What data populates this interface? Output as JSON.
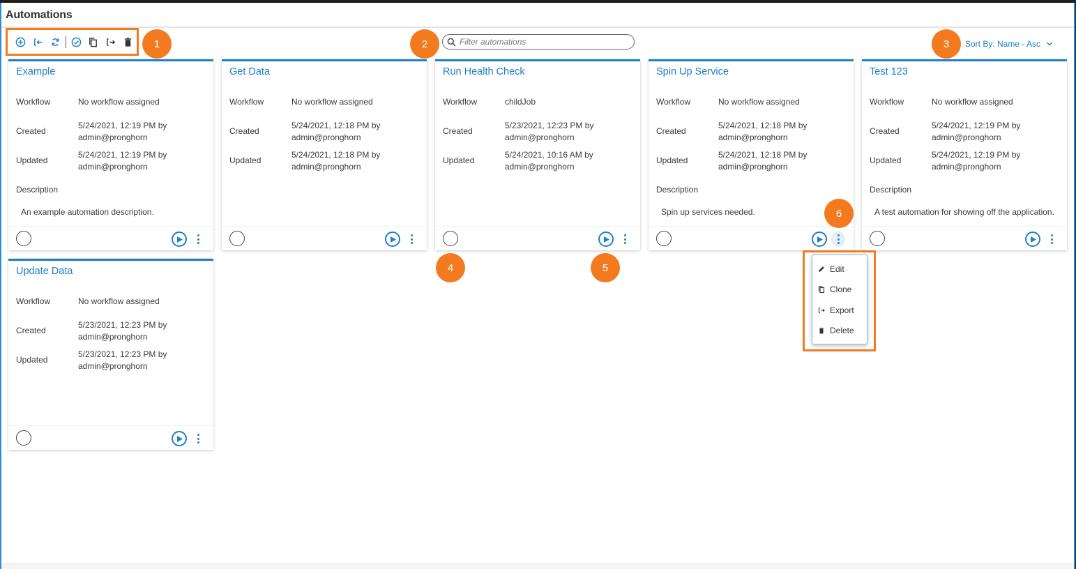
{
  "header": {
    "title": "Automations"
  },
  "toolbar": {
    "icons": [
      "add-icon",
      "import-icon",
      "refresh-icon",
      "select-all-icon",
      "clone-icon",
      "export-icon",
      "delete-icon"
    ]
  },
  "filter": {
    "placeholder": "Filter automations",
    "value": ""
  },
  "sort": {
    "label": "Sort By: Name - Asc"
  },
  "callouts": [
    "1",
    "2",
    "3",
    "4",
    "5",
    "6"
  ],
  "labels": {
    "workflow": "Workflow",
    "created": "Created",
    "updated": "Updated",
    "description": "Description"
  },
  "cards": [
    {
      "title": "Example",
      "workflow": "No workflow assigned",
      "created_line1": "5/24/2021, 12:19 PM by",
      "created_line2": "admin@pronghorn",
      "updated_line1": "5/24/2021, 12:19 PM by",
      "updated_line2": "admin@pronghorn",
      "description": "An example automation description."
    },
    {
      "title": "Get Data",
      "workflow": "No workflow assigned",
      "created_line1": "5/24/2021, 12:18 PM by",
      "created_line2": "admin@pronghorn",
      "updated_line1": "5/24/2021, 12:18 PM by",
      "updated_line2": "admin@pronghorn",
      "description": ""
    },
    {
      "title": "Run Health Check",
      "workflow": "childJob",
      "created_line1": "5/23/2021, 12:23 PM by",
      "created_line2": "admin@pronghorn",
      "updated_line1": "5/24/2021, 10:16 AM by",
      "updated_line2": "admin@pronghorn",
      "description": ""
    },
    {
      "title": "Spin Up Service",
      "workflow": "No workflow assigned",
      "created_line1": "5/24/2021, 12:18 PM by",
      "created_line2": "admin@pronghorn",
      "updated_line1": "5/24/2021, 12:18 PM by",
      "updated_line2": "admin@pronghorn",
      "description": "Spin up services needed."
    },
    {
      "title": "Test 123",
      "workflow": "No workflow assigned",
      "created_line1": "5/24/2021, 12:19 PM by",
      "created_line2": "admin@pronghorn",
      "updated_line1": "5/24/2021, 12:19 PM by",
      "updated_line2": "admin@pronghorn",
      "description": "A test automation for showing off the application."
    },
    {
      "title": "Update Data",
      "workflow": "No workflow assigned",
      "created_line1": "5/23/2021, 12:23 PM by",
      "created_line2": "admin@pronghorn",
      "updated_line1": "5/23/2021, 12:23 PM by",
      "updated_line2": "admin@pronghorn",
      "description": ""
    }
  ],
  "context_menu": {
    "items": [
      {
        "label": "Edit",
        "icon": "pencil-icon"
      },
      {
        "label": "Clone",
        "icon": "clone-icon"
      },
      {
        "label": "Export",
        "icon": "export-icon"
      },
      {
        "label": "Delete",
        "icon": "trash-icon"
      }
    ]
  },
  "colors": {
    "accent": "#1f7fc8",
    "callout": "#f37a1f"
  }
}
